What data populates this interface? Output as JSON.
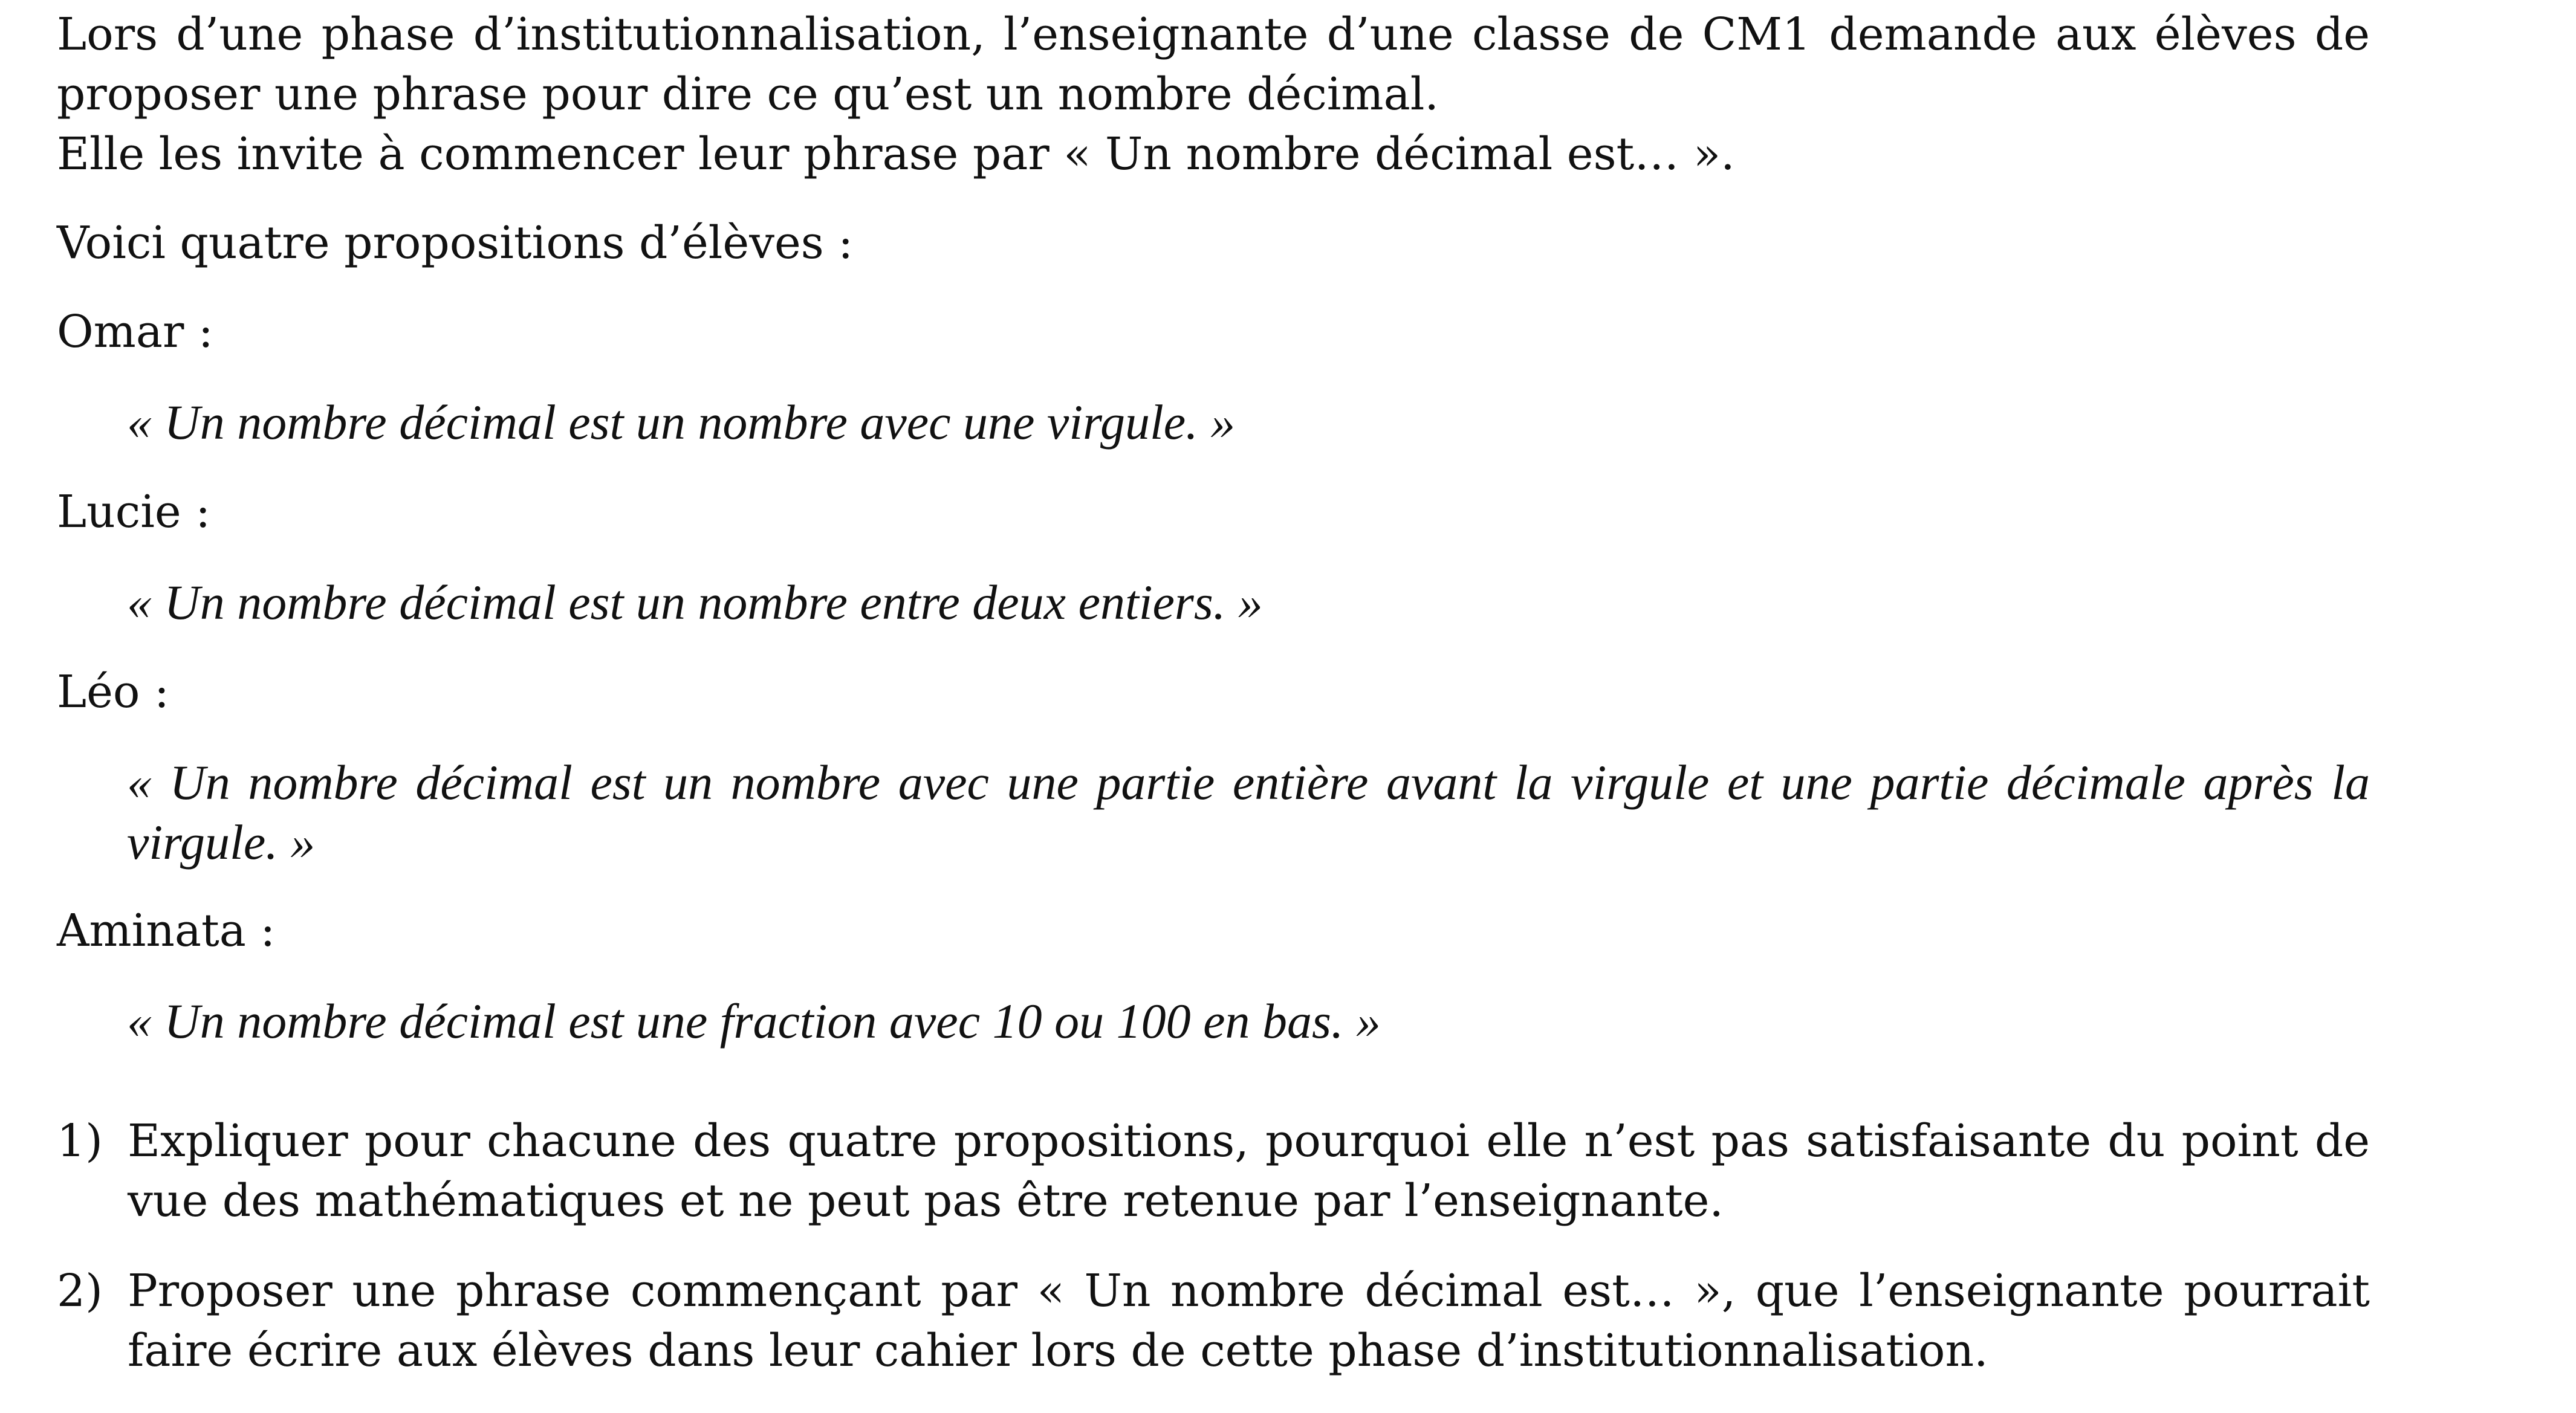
{
  "intro": {
    "line1": "Lors d’une phase d’institutionnalisation, l’enseignante d’une classe de CM1 demande aux élèves de proposer une phrase pour dire ce qu’est un nombre décimal.",
    "line2": "Elle les invite à commencer leur phrase par « Un nombre décimal est… »."
  },
  "lead": "Voici quatre propositions d’élèves :",
  "propositions": [
    {
      "name": "Omar :",
      "quote": "« Un nombre décimal est un nombre avec une virgule. »"
    },
    {
      "name": "Lucie :",
      "quote": "« Un nombre décimal est un nombre entre deux entiers. »"
    },
    {
      "name": "Léo :",
      "quote": "« Un nombre décimal est un nombre avec une partie entière avant la virgule et une partie décimale après la virgule. »"
    },
    {
      "name": "Aminata :",
      "quote": "« Un nombre décimal est une fraction avec 10 ou 100 en bas. »"
    }
  ],
  "questions": [
    {
      "number": "1)",
      "text": "Expliquer pour chacune des quatre propositions, pourquoi elle n’est pas satisfaisante du point de vue des mathématiques et ne peut pas être retenue par l’enseignante."
    },
    {
      "number": "2)",
      "text": "Proposer une phrase commençant par « Un nombre décimal est… », que l’enseignante pourrait faire écrire aux élèves dans leur cahier lors de cette phase d’institutionnalisation."
    }
  ]
}
